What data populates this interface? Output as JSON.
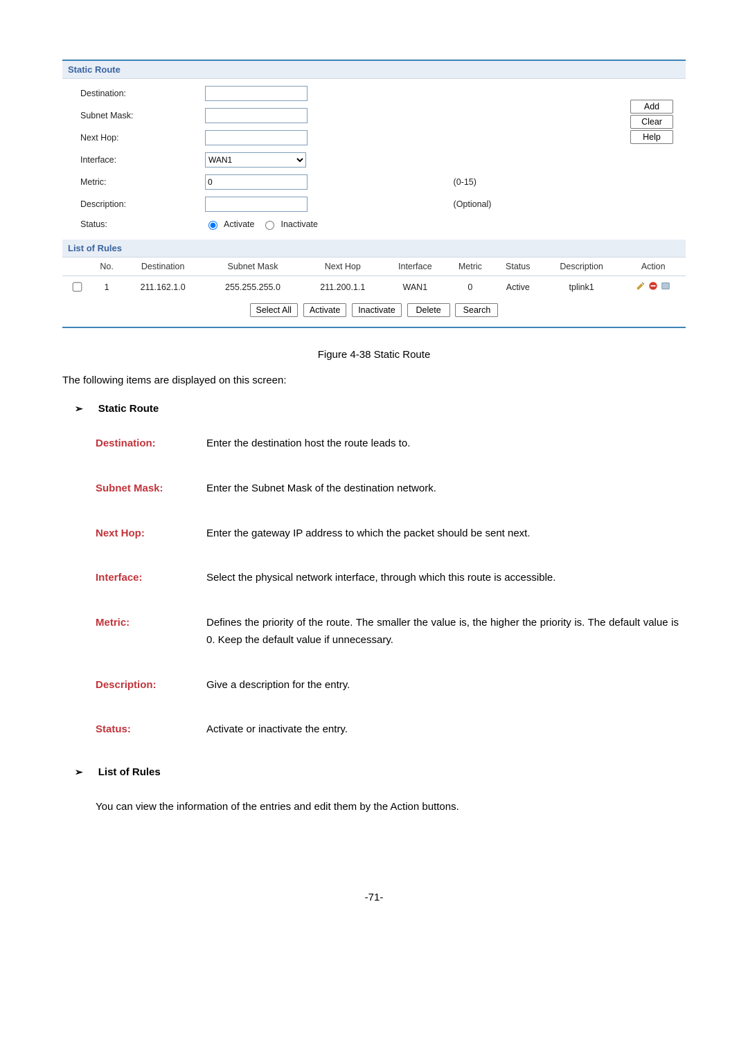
{
  "panel": {
    "section_static_route": "Static Route",
    "labels": {
      "destination": "Destination:",
      "subnet_mask": "Subnet Mask:",
      "next_hop": "Next Hop:",
      "interface": "Interface:",
      "metric": "Metric:",
      "description": "Description:",
      "status": "Status:"
    },
    "interface_sel": "WAN1",
    "metric_val": "0",
    "metric_hint": "(0-15)",
    "desc_hint": "(Optional)",
    "radio_activate": "Activate",
    "radio_inactivate": "Inactivate",
    "btn_add": "Add",
    "btn_clear": "Clear",
    "btn_help": "Help",
    "section_rules": "List of Rules",
    "cols": {
      "no": "No.",
      "destination": "Destination",
      "subnet_mask": "Subnet Mask",
      "next_hop": "Next Hop",
      "interface": "Interface",
      "metric": "Metric",
      "status": "Status",
      "description": "Description",
      "action": "Action"
    },
    "rows": [
      {
        "no": "1",
        "destination": "211.162.1.0",
        "subnet_mask": "255.255.255.0",
        "next_hop": "211.200.1.1",
        "interface": "WAN1",
        "metric": "0",
        "status": "Active",
        "description": "tplink1"
      }
    ],
    "btns": {
      "select_all": "Select All",
      "activate": "Activate",
      "inactivate": "Inactivate",
      "delete": "Delete",
      "search": "Search"
    }
  },
  "figure_caption": "Figure 4-38 Static Route",
  "intro_text": "The following items are displayed on this screen:",
  "sec1_title": "Static Route",
  "fields": [
    {
      "label": "Destination:",
      "desc": "Enter the destination host the route leads to."
    },
    {
      "label": "Subnet Mask:",
      "desc": "Enter the Subnet Mask of the destination network."
    },
    {
      "label": "Next Hop:",
      "desc": "Enter the gateway IP address to which the packet should be sent next."
    },
    {
      "label": "Interface:",
      "desc": "Select the physical network interface, through which this route is accessible."
    },
    {
      "label": "Metric:",
      "desc": "Defines the priority of the route. The smaller the value is, the higher the priority is. The default value is 0. Keep the default value if unnecessary."
    },
    {
      "label": "Description:",
      "desc": "Give a description for the entry."
    },
    {
      "label": "Status:",
      "desc": "Activate or inactivate the entry."
    }
  ],
  "sec2_title": "List of Rules",
  "sec2_body": "You can view the information of the entries and edit them by the Action buttons.",
  "page_number": "-71-"
}
